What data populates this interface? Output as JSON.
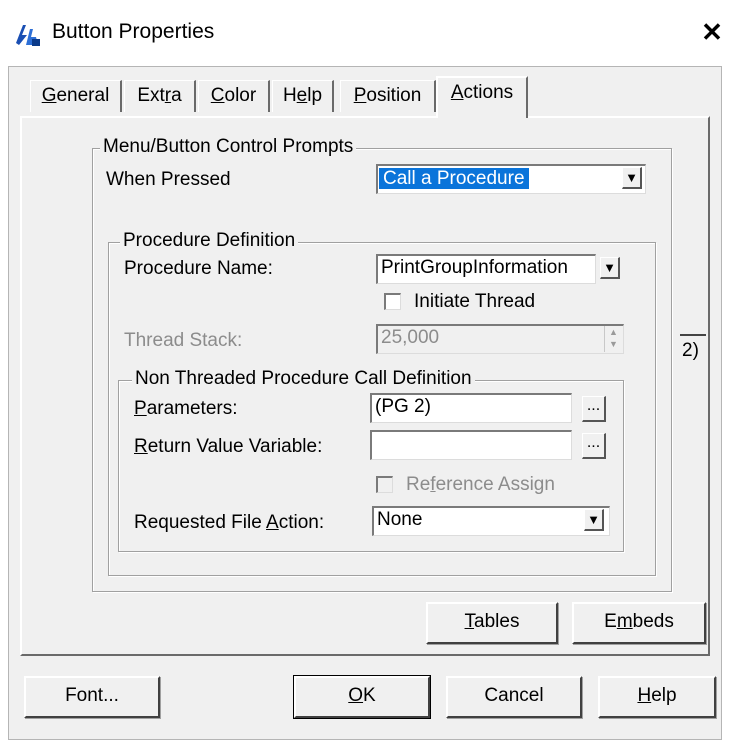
{
  "window": {
    "title": "Button Properties",
    "close_label": "✕"
  },
  "tabs": [
    {
      "label": "General",
      "ul": "G",
      "rest": "eneral"
    },
    {
      "label": "Extra",
      "pre": "Ext",
      "ul": "r",
      "rest": "a"
    },
    {
      "label": "Color",
      "ul": "C",
      "rest": "olor"
    },
    {
      "label": "Help",
      "pre": "H",
      "ul": "e",
      "rest": "lp"
    },
    {
      "label": "Position",
      "ul": "P",
      "rest": "osition"
    },
    {
      "label": "Actions",
      "ul": "A",
      "rest": "ctions",
      "active": true
    }
  ],
  "menu_group": {
    "legend": "Menu/Button Control Prompts",
    "when_pressed_label": "When Pressed",
    "when_pressed_value": "Call a Procedure"
  },
  "procedure_group": {
    "legend": "Procedure Definition",
    "name_label": "Procedure Name:",
    "name_value": "PrintGroupInformation",
    "initiate_thread_label": "Initiate Thread",
    "initiate_thread_checked": false,
    "thread_stack_label": "Thread Stack:",
    "thread_stack_value": "25,000"
  },
  "call_group": {
    "legend": "Non Threaded Procedure Call Definition",
    "parameters_label_ul": "P",
    "parameters_label_rest": "arameters:",
    "parameters_value": "(PG 2)",
    "return_label_ul": "R",
    "return_label_rest": "eturn Value Variable:",
    "return_value": "",
    "ellipsis": "...",
    "reference_assign_pre": "Re",
    "reference_assign_ul": "f",
    "reference_assign_rest": "erence Assign",
    "reference_assign_checked": false,
    "file_action_label_pre": "Requested File ",
    "file_action_label_ul": "A",
    "file_action_label_rest": "ction:",
    "file_action_value": "None"
  },
  "side_snippet": "2)",
  "panel_buttons": {
    "tables_ul": "T",
    "tables_rest": "ables",
    "embeds_pre": "E",
    "embeds_ul": "m",
    "embeds_rest": "beds"
  },
  "footer_buttons": {
    "font": "Font...",
    "ok_ul": "O",
    "ok_rest": "K",
    "cancel": "Cancel",
    "help_ul": "H",
    "help_rest": "elp"
  },
  "dropdown_arrow": "▼",
  "colors": {
    "selection": "#0a74da",
    "face": "#f0f0f0"
  }
}
